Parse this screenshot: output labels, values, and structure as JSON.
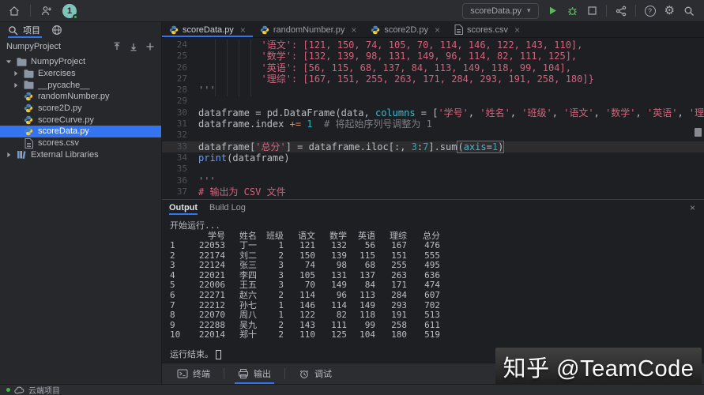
{
  "colors": {
    "accent": "#3574f0",
    "run_green": "#57b85c",
    "selection_blue": "#3574f0",
    "string_pink": "#d4627d",
    "editor_bg": "#1e1f22",
    "chrome_bg": "#2b2d30"
  },
  "topbar": {
    "run_config_label": "scoreData.py",
    "avatar_badge": "1"
  },
  "sidebar": {
    "tool_tab_label": "项目",
    "project_name": "NumpyProject",
    "tree": [
      {
        "label": "NumpyProject",
        "icon": "folder",
        "chevron": "down",
        "indent": 0,
        "selected": false
      },
      {
        "label": "Exercises",
        "icon": "folder",
        "chevron": "right",
        "indent": 1,
        "selected": false
      },
      {
        "label": "__pycache__",
        "icon": "folder",
        "chevron": "right",
        "indent": 1,
        "selected": false
      },
      {
        "label": "randomNumber.py",
        "icon": "python",
        "chevron": null,
        "indent": 1,
        "selected": false
      },
      {
        "label": "score2D.py",
        "icon": "python",
        "chevron": null,
        "indent": 1,
        "selected": false
      },
      {
        "label": "scoreCurve.py",
        "icon": "python",
        "chevron": null,
        "indent": 1,
        "selected": false
      },
      {
        "label": "scoreData.py",
        "icon": "python",
        "chevron": null,
        "indent": 1,
        "selected": true
      },
      {
        "label": "scores.csv",
        "icon": "file",
        "chevron": null,
        "indent": 1,
        "selected": false
      },
      {
        "label": "External Libraries",
        "icon": "library",
        "chevron": "right",
        "indent": 0,
        "selected": false
      }
    ]
  },
  "editor_tabs": [
    {
      "label": "scoreData.py",
      "icon": "python",
      "active": true
    },
    {
      "label": "randomNumber.py",
      "icon": "python",
      "active": false
    },
    {
      "label": "score2D.py",
      "icon": "python",
      "active": false
    },
    {
      "label": "scores.csv",
      "icon": "file",
      "active": false
    }
  ],
  "editor": {
    "lines": [
      {
        "num": 24,
        "cur": false,
        "segs": [
          {
            "t": "           '语文': [121, 150, 74, 105, 70, 114, 146, 122, 143, 110],",
            "c": "str"
          }
        ]
      },
      {
        "num": 25,
        "cur": false,
        "segs": [
          {
            "t": "           '数学': [132, 139, 98, 131, 149, 96, 114, 82, 111, 125],",
            "c": "str"
          }
        ]
      },
      {
        "num": 26,
        "cur": false,
        "segs": [
          {
            "t": "           '英语': [56, 115, 68, 137, 84, 113, 149, 118, 99, 104],",
            "c": "str"
          }
        ]
      },
      {
        "num": 27,
        "cur": false,
        "segs": [
          {
            "t": "           '理综': [167, 151, 255, 263, 171, 284, 293, 191, 258, 180]}",
            "c": "str"
          }
        ]
      },
      {
        "num": 28,
        "cur": false,
        "segs": [
          {
            "t": "'''",
            "c": "cm2"
          }
        ]
      },
      {
        "num": 29,
        "cur": false,
        "segs": []
      },
      {
        "num": 30,
        "cur": false,
        "segs": [
          {
            "t": "dataframe = pd.DataFrame(data, ",
            "c": "plain"
          },
          {
            "t": "columns",
            "c": "arg"
          },
          {
            "t": " = [",
            "c": "plain"
          },
          {
            "t": "'学号'",
            "c": "str"
          },
          {
            "t": ", ",
            "c": "plain"
          },
          {
            "t": "'姓名'",
            "c": "str"
          },
          {
            "t": ", ",
            "c": "plain"
          },
          {
            "t": "'班级'",
            "c": "str"
          },
          {
            "t": ", ",
            "c": "plain"
          },
          {
            "t": "'语文'",
            "c": "str"
          },
          {
            "t": ", ",
            "c": "plain"
          },
          {
            "t": "'数学'",
            "c": "str"
          },
          {
            "t": ", ",
            "c": "plain"
          },
          {
            "t": "'英语'",
            "c": "str"
          },
          {
            "t": ", ",
            "c": "plain"
          },
          {
            "t": "'理综'",
            "c": "str"
          },
          {
            "t": "])",
            "c": "plain"
          }
        ]
      },
      {
        "num": 31,
        "cur": false,
        "segs": [
          {
            "t": "dataframe.index ",
            "c": "plain"
          },
          {
            "t": "+= ",
            "c": "kw"
          },
          {
            "t": "1",
            "c": "num"
          },
          {
            "t": "  ",
            "c": "plain"
          },
          {
            "t": "# 将起始序列号调整为 1",
            "c": "cm"
          }
        ]
      },
      {
        "num": 32,
        "cur": false,
        "segs": []
      },
      {
        "num": 33,
        "cur": true,
        "segs": [
          {
            "t": "dataframe[",
            "c": "plain"
          },
          {
            "t": "'总分'",
            "c": "str"
          },
          {
            "t": "] = dataframe.iloc[:, ",
            "c": "plain"
          },
          {
            "t": "3",
            "c": "num"
          },
          {
            "t": ":",
            "c": "plain"
          },
          {
            "t": "7",
            "c": "num"
          },
          {
            "t": "].sum",
            "c": "plain"
          },
          {
            "t": "(",
            "c": "plain bx bxl"
          },
          {
            "t": "axis",
            "c": "arg bx"
          },
          {
            "t": "=",
            "c": "plain bx"
          },
          {
            "t": "1",
            "c": "num bx"
          },
          {
            "t": ")",
            "c": "plain bx bxr"
          }
        ]
      },
      {
        "num": 34,
        "cur": false,
        "segs": [
          {
            "t": "print",
            "c": "builtin"
          },
          {
            "t": "(dataframe)",
            "c": "plain"
          }
        ]
      },
      {
        "num": 35,
        "cur": false,
        "segs": []
      },
      {
        "num": 36,
        "cur": false,
        "segs": [
          {
            "t": "'''",
            "c": "cm2"
          }
        ]
      },
      {
        "num": 37,
        "cur": false,
        "segs": [
          {
            "t": "# 输出为 CSV 文件",
            "c": "str"
          }
        ]
      }
    ]
  },
  "output": {
    "tabs": [
      {
        "label": "Output",
        "active": true
      },
      {
        "label": "Build Log",
        "active": false
      }
    ],
    "start_text": "开始运行...",
    "end_text": "运行结束。",
    "table": {
      "headers": [
        "学号",
        "姓名",
        "班级",
        "语文",
        "数学",
        "英语",
        "理综",
        "总分"
      ],
      "rows": [
        [
          "1",
          "22053",
          "丁一",
          "1",
          "121",
          "132",
          "56",
          "167",
          "476"
        ],
        [
          "2",
          "22174",
          "刘二",
          "2",
          "150",
          "139",
          "115",
          "151",
          "555"
        ],
        [
          "3",
          "22124",
          "张三",
          "3",
          "74",
          "98",
          "68",
          "255",
          "495"
        ],
        [
          "4",
          "22021",
          "李四",
          "3",
          "105",
          "131",
          "137",
          "263",
          "636"
        ],
        [
          "5",
          "22006",
          "王五",
          "3",
          "70",
          "149",
          "84",
          "171",
          "474"
        ],
        [
          "6",
          "22271",
          "赵六",
          "2",
          "114",
          "96",
          "113",
          "284",
          "607"
        ],
        [
          "7",
          "22212",
          "孙七",
          "1",
          "146",
          "114",
          "149",
          "293",
          "702"
        ],
        [
          "8",
          "22070",
          "周八",
          "1",
          "122",
          "82",
          "118",
          "191",
          "513"
        ],
        [
          "9",
          "22288",
          "吴九",
          "2",
          "143",
          "111",
          "99",
          "258",
          "611"
        ],
        [
          "10",
          "22014",
          "郑十",
          "2",
          "110",
          "125",
          "104",
          "180",
          "519"
        ]
      ]
    }
  },
  "bottom_toolbar": {
    "items": [
      {
        "label": "终端",
        "icon": "terminal",
        "active": false
      },
      {
        "label": "输出",
        "icon": "output",
        "active": true
      },
      {
        "label": "调试",
        "icon": "debug",
        "active": false
      }
    ]
  },
  "statusbar": {
    "project_label": "云端项目"
  },
  "watermark": {
    "text": "知乎 @TeamCode"
  }
}
